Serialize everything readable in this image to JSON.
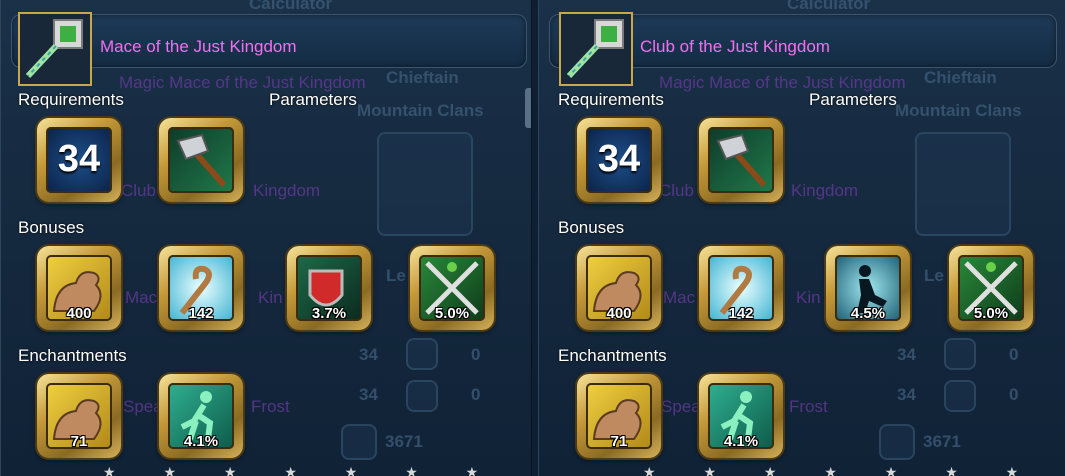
{
  "left": {
    "title": "Mace of the Just Kingdom",
    "background": {
      "ghost_name_1": "Magic Mace of the Just Kingdom",
      "ghost_name_2": "Club",
      "ghost_name_3": "Kingdom",
      "ghost_name_4": "Mac",
      "ghost_name_5": "Kin",
      "ghost_name_6": "Spea",
      "ghost_name_7": "Frost",
      "ghost_calc": "Calculator",
      "ghost_chief": "Chieftain",
      "ghost_clans": "Mountain Clans",
      "ghost_le": "Le",
      "ghost_34a": "34",
      "ghost_0a": "0",
      "ghost_34b": "34",
      "ghost_0b": "0",
      "ghost_3671": "3671"
    },
    "headings": {
      "requirements": "Requirements",
      "parameters": "Parameters",
      "bonuses": "Bonuses",
      "enchantments": "Enchantments"
    },
    "level_requirement": "34",
    "bonuses": [
      {
        "icon": "strength-icon",
        "value": "400"
      },
      {
        "icon": "agility-staff-icon",
        "value": "142"
      },
      {
        "icon": "bleeding-shield-icon",
        "value": "3.7%"
      },
      {
        "icon": "crossed-weapons-icon",
        "value": "5.0%"
      }
    ],
    "enchantments": [
      {
        "icon": "strength-icon",
        "value": "71"
      },
      {
        "icon": "running-man-icon",
        "value": "4.1%"
      }
    ]
  },
  "right": {
    "title": "Club of the Just Kingdom",
    "background": {
      "ghost_name_1": "Magic Mace of the Just Kingdom",
      "ghost_name_2": "Club",
      "ghost_name_3": "Kingdom",
      "ghost_name_4": "Mac",
      "ghost_name_5": "Kin",
      "ghost_name_6": "Spea",
      "ghost_name_7": "Frost",
      "ghost_calc": "Calculator",
      "ghost_chief": "Chieftain",
      "ghost_clans": "Mountain Clans",
      "ghost_le": "Le",
      "ghost_34a": "34",
      "ghost_0a": "0",
      "ghost_34b": "34",
      "ghost_0b": "0",
      "ghost_3671": "3671"
    },
    "headings": {
      "requirements": "Requirements",
      "parameters": "Parameters",
      "bonuses": "Bonuses",
      "enchantments": "Enchantments"
    },
    "level_requirement": "34",
    "bonuses": [
      {
        "icon": "strength-icon",
        "value": "400"
      },
      {
        "icon": "agility-staff-icon",
        "value": "142"
      },
      {
        "icon": "evasion-silhouette-icon",
        "value": "4.5%"
      },
      {
        "icon": "crossed-weapons-icon",
        "value": "5.0%"
      }
    ],
    "enchantments": [
      {
        "icon": "strength-icon",
        "value": "71"
      },
      {
        "icon": "running-man-icon",
        "value": "4.1%"
      }
    ]
  },
  "colors": {
    "title": "#f070f0",
    "heading": "#ffffff",
    "slot_gold": "#c69a3a",
    "ghost_purple": "#6a3aa0"
  },
  "stars": "★ ★ ★ ★ ★ ★ ★ ★ ★ ★"
}
